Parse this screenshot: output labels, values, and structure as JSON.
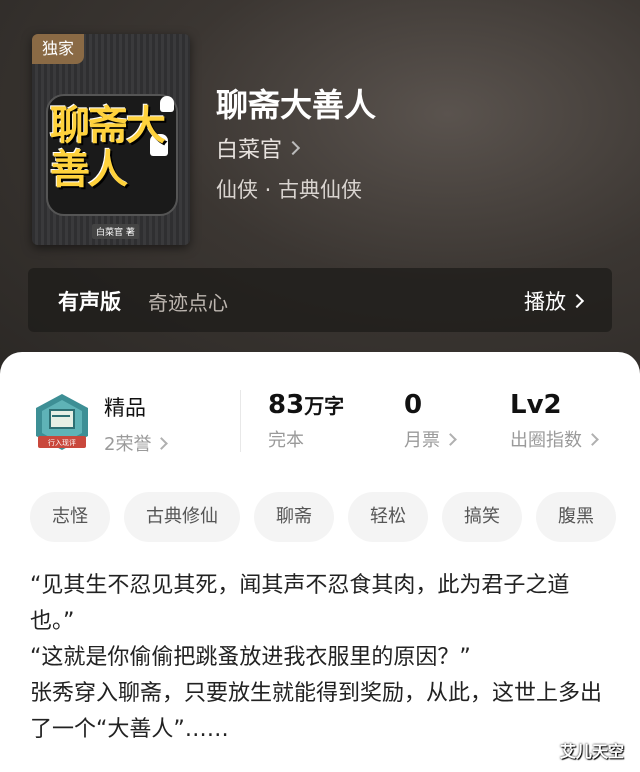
{
  "cover": {
    "badge": "独家",
    "title": "聊斋大善人",
    "author_small": "白菜官 著"
  },
  "book": {
    "title": "聊斋大善人",
    "author": "白菜官",
    "genre": "仙侠 · 古典仙侠"
  },
  "audio": {
    "label": "有声版",
    "narrator": "奇迹点心",
    "play_label": "播放"
  },
  "stats": {
    "medal_text": "行入现评",
    "quality_label": "精品",
    "honor": "2荣誉",
    "word_count": "83",
    "word_unit": "万字",
    "status": "完本",
    "monthly_tickets": "0",
    "monthly_label": "月票",
    "level": "Lv2",
    "level_label": "出圈指数"
  },
  "tags": [
    "志怪",
    "古典修仙",
    "聊斋",
    "轻松",
    "搞笑",
    "腹黑"
  ],
  "synopsis": [
    "“见其生不忍见其死，闻其声不忍食其肉，此为君子之道也。”",
    "“这就是你偷偷把跳蚤放进我衣服里的原因？”",
    "张秀穿入聊斋，只要放生就能得到奖励，从此，这世上多出了一个“大善人”……"
  ],
  "watermark": "艾儿天空",
  "colors": {
    "hero_bg": "#3b3632",
    "badge_bg": "#8a6a45",
    "cover_title": "#ffd23c",
    "tag_bg": "#f4f4f4"
  }
}
